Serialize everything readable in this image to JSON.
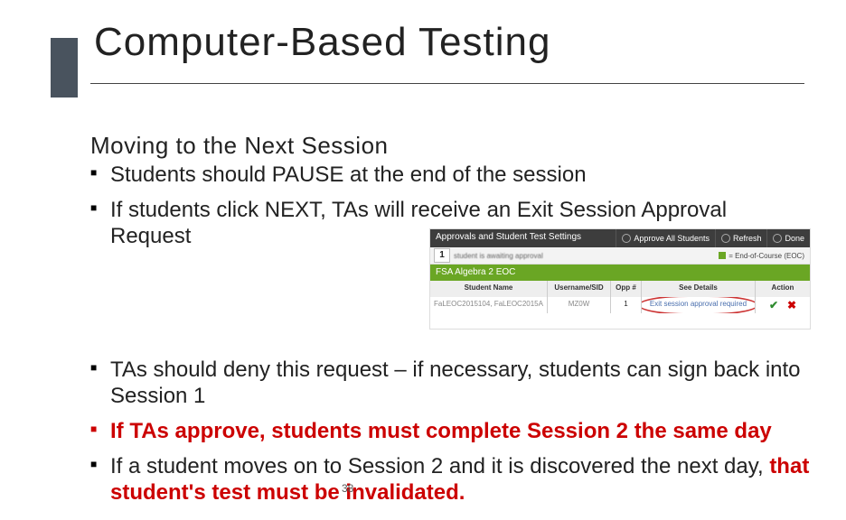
{
  "title": "Computer-Based Testing",
  "subtitle": "Moving to the Next Session",
  "bullets": {
    "b1": "Students should PAUSE at the end of the session",
    "b2": "If students click NEXT, TAs will receive an Exit Session Approval Request",
    "b3": "TAs should deny this request – if necessary, students can sign back into Session 1",
    "b4": "If TAs approve, students must complete Session 2 the same day",
    "b5_a": "If a student moves on to Session 2 and it is discovered the next day, ",
    "b5_b": "that student's test must be invalidated."
  },
  "panel": {
    "header_title": "Approvals and Student Test Settings",
    "btn_approve": "Approve All Students",
    "btn_refresh": "Refresh",
    "btn_done": "Done",
    "count": "1",
    "awaiting": "student is awaiting approval",
    "legend": "= End-of-Course (EOC)",
    "green_title": "FSA Algebra 2 EOC",
    "cols": {
      "name": "Student Name",
      "user": "Username/SID",
      "opp": "Opp #",
      "det": "See Details",
      "act": "Action"
    },
    "row": {
      "name": "FaLEOC2015104, FaLEOC2015A",
      "user": "MZ0W",
      "opp": "1",
      "det": "Exit session approval required"
    }
  },
  "page_number": "38"
}
